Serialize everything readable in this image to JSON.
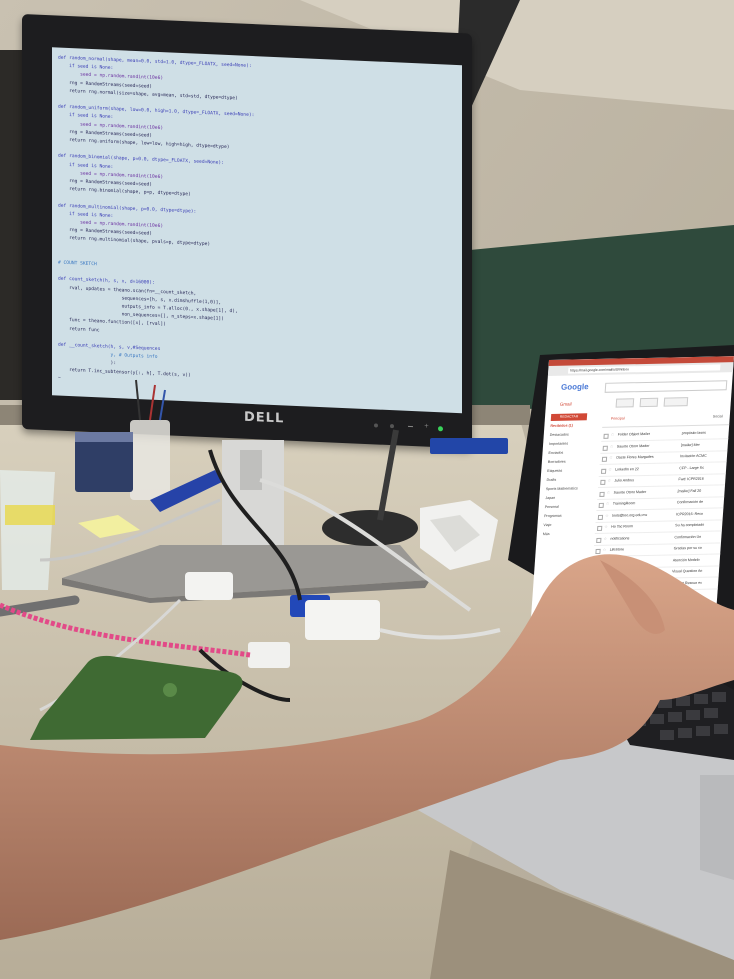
{
  "monitor": {
    "brand": "DELL",
    "code_lines": [
      {
        "text": "def random_normal(shape, mean=0.0, std=1.0, dtype=_FLOATX, seed=None):",
        "c": "k"
      },
      {
        "text": "    if seed is None:",
        "c": "k"
      },
      {
        "text": "        seed = np.random.randint(10e6)",
        "c": "s"
      },
      {
        "text": "    rng = RandomStreams(seed=seed)",
        "c": "n"
      },
      {
        "text": "    return rng.normal(size=shape, avg=mean, std=std, dtype=dtype)",
        "c": "n"
      },
      {
        "text": "",
        "c": "n"
      },
      {
        "text": "def random_uniform(shape, low=0.0, high=1.0, dtype=_FLOATX, seed=None):",
        "c": "k"
      },
      {
        "text": "    if seed is None:",
        "c": "k"
      },
      {
        "text": "        seed = np.random.randint(10e6)",
        "c": "s"
      },
      {
        "text": "    rng = RandomStreams(seed=seed)",
        "c": "n"
      },
      {
        "text": "    return rng.uniform(shape, low=low, high=high, dtype=dtype)",
        "c": "n"
      },
      {
        "text": "",
        "c": "n"
      },
      {
        "text": "def random_binomial(shape, p=0.0, dtype=_FLOATX, seed=None):",
        "c": "k"
      },
      {
        "text": "    if seed is None:",
        "c": "k"
      },
      {
        "text": "        seed = np.random.randint(10e6)",
        "c": "s"
      },
      {
        "text": "    rng = RandomStreams(seed=seed)",
        "c": "n"
      },
      {
        "text": "    return rng.binomial(shape, p=p, dtype=dtype)",
        "c": "n"
      },
      {
        "text": "",
        "c": "n"
      },
      {
        "text": "def random_multinomial(shape, p=0.0, dtype=dtype):",
        "c": "k"
      },
      {
        "text": "    if seed is None:",
        "c": "k"
      },
      {
        "text": "        seed = np.random.randint(10e6)",
        "c": "s"
      },
      {
        "text": "    rng = RandomStreams(seed=seed)",
        "c": "n"
      },
      {
        "text": "    return rng.multinomial(shape, pvals=p, dtype=dtype)",
        "c": "n"
      },
      {
        "text": "",
        "c": "n"
      },
      {
        "text": "",
        "c": "n"
      },
      {
        "text": "# COUNT SKETCH",
        "c": "c"
      },
      {
        "text": "",
        "c": "n"
      },
      {
        "text": "def count_sketch(h, s, x, d=16000):",
        "c": "k"
      },
      {
        "text": "    rval, updates = theano.scan(fn=__count_sketch,",
        "c": "n"
      },
      {
        "text": "                       sequences=[h, s, x.dimshuffle(1,0)],",
        "c": "n"
      },
      {
        "text": "                       outputs_info = T.alloc(0., x.shape[1], d),",
        "c": "n"
      },
      {
        "text": "                       non_sequences=[], n_steps=x.shape[1])",
        "c": "n"
      },
      {
        "text": "    func = theano.function([x], [rval])",
        "c": "n"
      },
      {
        "text": "    return func",
        "c": "n"
      },
      {
        "text": "",
        "c": "n"
      },
      {
        "text": "def __count_sketch(h, s, v,#Sequences",
        "c": "k"
      },
      {
        "text": "                   y, # Outputs info",
        "c": "c"
      },
      {
        "text": "                   ):",
        "c": "n"
      },
      {
        "text": "    return T.inc_subtensor(y[:, h], T.dot(s, v))",
        "c": "n"
      },
      {
        "text": "~",
        "c": "n"
      }
    ]
  },
  "laptop": {
    "url": "https://mail.google.com/mail/u/0/#inbox",
    "brand": "Google",
    "app": "Gmail",
    "compose_label": "REDACTAR",
    "tabs": [
      "Principal",
      "Social"
    ],
    "sidebar": [
      "Recibidos (1)",
      "Destacados",
      "Importantes",
      "Enviados",
      "Borradores",
      "Etiquetas",
      "Drafts",
      "Sports Mathematics",
      "Japan",
      "Personal",
      "Programas",
      "Viaje",
      "Más"
    ],
    "rows": [
      {
        "from": "Folder Object Mailer",
        "subject": "propósito lasos"
      },
      {
        "from": "Saunte Otoro Mader",
        "subject": "[mailer] Mer"
      },
      {
        "from": "Oaste Flores Margades",
        "subject": "Invitación ACMC"
      },
      {
        "from": "LinkedIn en 22",
        "subject": "CFP - Large Sc"
      },
      {
        "from": "Julio Andrus",
        "subject": "Fwd: ICPR2016"
      },
      {
        "from": "Saunte Otoro Mader",
        "subject": "[mailer] Fall 20"
      },
      {
        "from": "TrainingRoom",
        "subject": "Confirmación de"
      },
      {
        "from": "tools@teo.org.edu.mx",
        "subject": "ICPR2016: Reco"
      },
      {
        "from": "Ho Tac Room",
        "subject": "Su ha completado"
      },
      {
        "from": "notifications",
        "subject": "Confirmación Un"
      },
      {
        "from": "LifeStore",
        "subject": "Gracias por su co"
      },
      {
        "from": "Mero (2)",
        "subject": "Atención Modelo"
      },
      {
        "from": "Yourself",
        "subject": "Visual Question An"
      },
      {
        "from": "Ehamplum",
        "subject": "[Distinct Rescue ev"
      }
    ]
  },
  "colors": {
    "screen": "#cfdfe6",
    "code_keyword": "#3b3fb6",
    "code_comment": "#3a78c2",
    "code_string": "#6a2fa0",
    "code_normal": "#2a2a58",
    "gmail_red": "#d14836",
    "chalkboard": "#2f4a3c"
  }
}
